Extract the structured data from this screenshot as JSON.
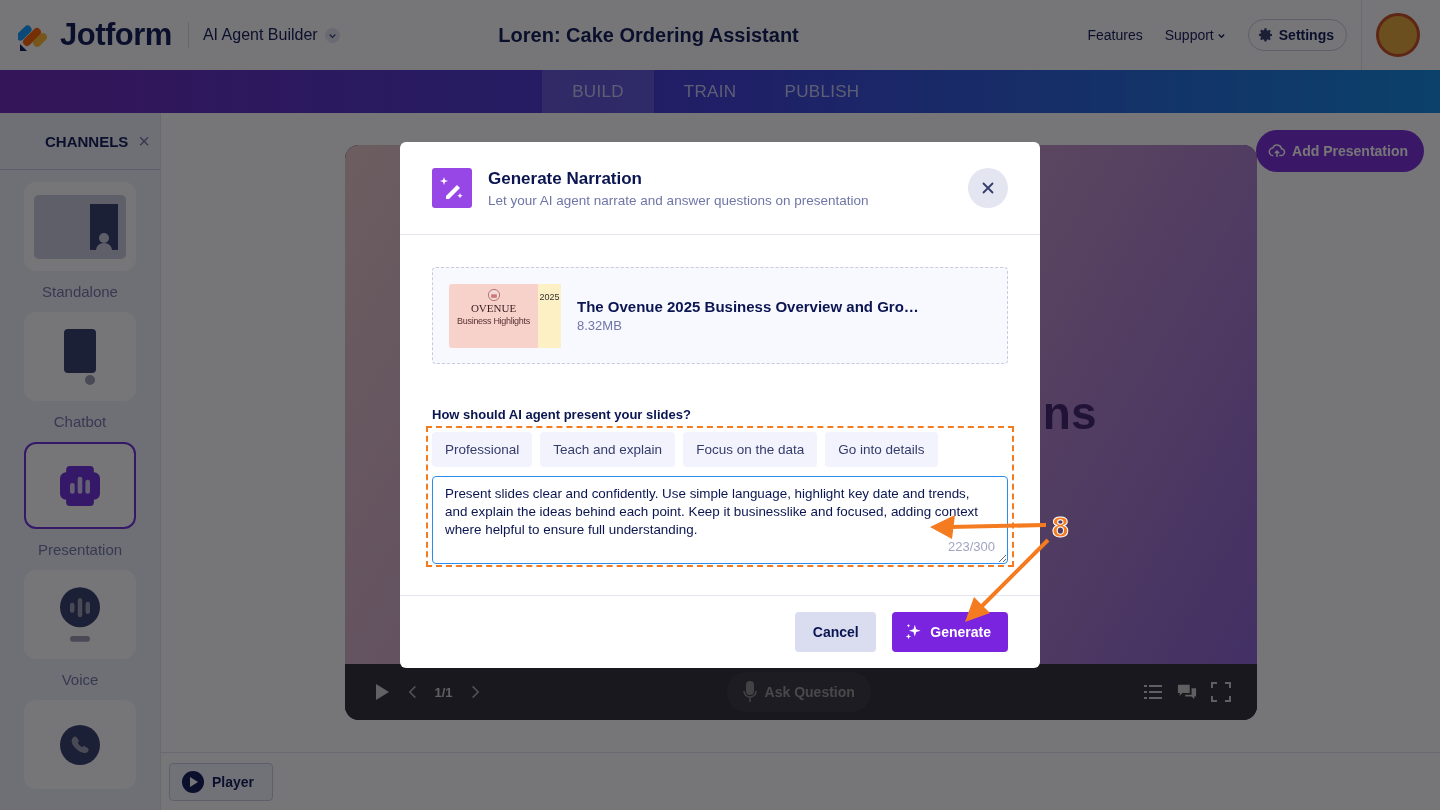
{
  "header": {
    "logo_text": "Jotform",
    "product": "AI Agent Builder",
    "agent_title": "Loren: Cake Ordering Assistant",
    "links": [
      "Features",
      "Support"
    ],
    "settings": "Settings"
  },
  "nav_tabs": [
    {
      "label": "BUILD",
      "selected": true
    },
    {
      "label": "TRAIN",
      "selected": false
    },
    {
      "label": "PUBLISH",
      "selected": false
    }
  ],
  "channels": {
    "title": "CHANNELS",
    "close": "×",
    "items": [
      {
        "label": "Standalone",
        "kind": "standalone",
        "selected": false
      },
      {
        "label": "Chatbot",
        "kind": "chatbot",
        "selected": false
      },
      {
        "label": "Presentation",
        "kind": "presentation",
        "selected": true
      },
      {
        "label": "Voice",
        "kind": "voice",
        "selected": false
      },
      {
        "kind": "phone",
        "selected": false
      }
    ]
  },
  "add_presentation": "Add Presentation",
  "slide": {
    "text": "ns",
    "page": "1/1",
    "ask": "Ask Question"
  },
  "player_button": "Player",
  "modal": {
    "title": "Generate Narration",
    "subtitle": "Let your AI agent narrate and answer questions on presentation",
    "file": {
      "name": "The Ovenue 2025 Business Overview and Gro…",
      "size": "8.32MB",
      "thumb": {
        "year": "2025",
        "brand": "OVENUE",
        "caption": "Business Highlights"
      }
    },
    "prompt_label": "How should AI agent present your slides?",
    "presets": [
      "Professional",
      "Teach and explain",
      "Focus on the data",
      "Go into details"
    ],
    "text": "Present slides clear and confidently. Use simple language, highlight key date and trends, and explain the ideas behind each point. Keep it businesslike and focused, adding context where helpful to ensure full understanding.",
    "counter": "223/300",
    "cancel": "Cancel",
    "generate": "Generate"
  },
  "annotation": {
    "number": "8"
  }
}
